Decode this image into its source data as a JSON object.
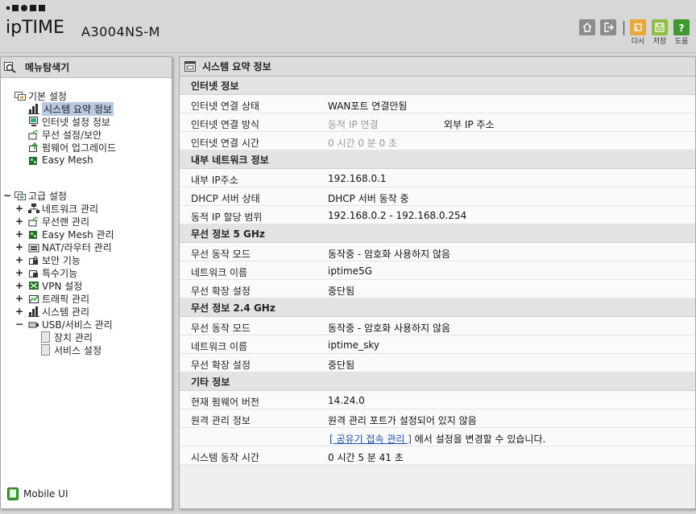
{
  "header": {
    "brand": "ipTIME",
    "model": "A3004NS-M",
    "buttons": {
      "home_label": "",
      "logout_label": "",
      "refresh_label": "다시",
      "save_label": "저장",
      "help_label": "도움"
    },
    "colors": {
      "refresh": "#e8a83a",
      "save": "#8cbf3f",
      "help": "#3e9a2f",
      "home": "#8c8c8c",
      "logout": "#8c8c8c"
    }
  },
  "sidebar": {
    "title": "메뉴탐색기",
    "basic": {
      "label": "기본 설정",
      "items": [
        {
          "label": "시스템 요약 정보",
          "icon": "chart-icon",
          "selected": true
        },
        {
          "label": "인터넷 설정 정보",
          "icon": "monitor-icon"
        },
        {
          "label": "무선 설정/보안",
          "icon": "wifi-icon"
        },
        {
          "label": "펌웨어 업그레이드",
          "icon": "upgrade-icon"
        },
        {
          "label": "Easy Mesh",
          "icon": "mesh-icon"
        }
      ]
    },
    "advanced": {
      "label": "고급 설정",
      "items": [
        {
          "label": "네트워크 관리",
          "icon": "network-icon"
        },
        {
          "label": "무선랜 관리",
          "icon": "wifi-icon"
        },
        {
          "label": "Easy Mesh 관리",
          "icon": "mesh-icon"
        },
        {
          "label": "NAT/라우터 관리",
          "icon": "router-icon"
        },
        {
          "label": "보안 기능",
          "icon": "lock-icon"
        },
        {
          "label": "특수기능",
          "icon": "special-icon"
        },
        {
          "label": "VPN 설정",
          "icon": "vpn-icon"
        },
        {
          "label": "트래픽 관리",
          "icon": "traffic-icon"
        },
        {
          "label": "시스템 관리",
          "icon": "chart-icon"
        },
        {
          "label": "USB/서비스 관리",
          "icon": "usb-icon"
        }
      ],
      "usb_children": [
        {
          "label": "장치 관리"
        },
        {
          "label": "서비스 설정"
        }
      ]
    },
    "mobile_label": "Mobile UI"
  },
  "main": {
    "title": "시스템 요약 정보",
    "sections": {
      "internet": {
        "title": "인터넷 정보",
        "rows": [
          {
            "key": "인터넷 연결 상태",
            "value": "WAN포트 연결안됨"
          },
          {
            "key": "인터넷 연결 방식",
            "value": "동적 IP 연결",
            "value2": "외부 IP 주소"
          },
          {
            "key": "인터넷 연결 시간",
            "value": "0 시간 0 분 0 초"
          }
        ]
      },
      "lan": {
        "title": "내부 네트워크 정보",
        "rows": [
          {
            "key": "내부 IP주소",
            "value": "192.168.0.1"
          },
          {
            "key": "DHCP 서버 상태",
            "value": "DHCP 서버 동작 중"
          },
          {
            "key": "동적 IP 할당 범위",
            "value": "192.168.0.2 -  192.168.0.254"
          }
        ]
      },
      "wifi5": {
        "title": "무선 정보 5 GHz",
        "rows": [
          {
            "key": "무선 동작 모드",
            "value": "동작중 - 암호화 사용하지 않음"
          },
          {
            "key": "네트워크 이름",
            "value": "iptime5G"
          },
          {
            "key": "무선 확장 설정",
            "value": "중단됨"
          }
        ]
      },
      "wifi24": {
        "title": "무선 정보 2.4 GHz",
        "rows": [
          {
            "key": "무선 동작 모드",
            "value": "동작중 - 암호화 사용하지 않음"
          },
          {
            "key": "네트워크 이름",
            "value": "iptime_sky"
          },
          {
            "key": "무선 확장 설정",
            "value": "중단됨"
          }
        ]
      },
      "etc": {
        "title": "기타 정보",
        "rows": [
          {
            "key": "현재 펌웨어 버전",
            "value": "14.24.0"
          },
          {
            "key": "원격 관리 정보",
            "value": "원격 관리 포트가 설정되어 있지 않음"
          },
          {
            "key": "",
            "link": "[ 공유기 접속 관리 ]",
            "suffix": " 에서 설정을 변경할 수 있습니다."
          },
          {
            "key": "시스템 동작 시간",
            "value": "0 시간 5 분 41 초"
          }
        ]
      }
    }
  }
}
